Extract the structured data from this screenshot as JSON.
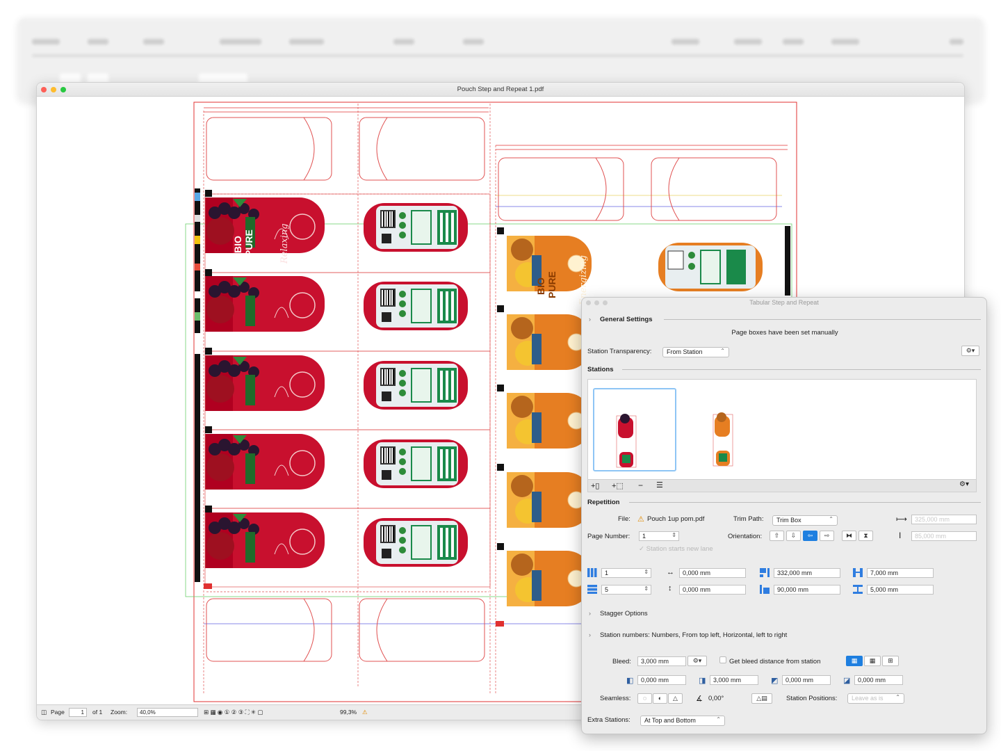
{
  "document": {
    "title": "Pouch Step and Repeat 1.pdf"
  },
  "statusbar": {
    "page_label": "Page",
    "page_value": "1",
    "of_label": "of 1",
    "zoom_label": "Zoom:",
    "zoom_value": "40,0%",
    "coverage_value": "99,3%"
  },
  "artwork": {
    "left_brand_line1": "BIO",
    "left_brand_line2": "PURE",
    "left_flavor": "Relaxing",
    "right_flavor": "Energizing",
    "left_color": "#c8102e",
    "right_color": "#e67e22",
    "nutrition_color": "#1a8a4a"
  },
  "panel": {
    "title": "Tabular Step and Repeat",
    "general_settings": "General Settings",
    "manual_note": "Page boxes have been set manually",
    "station_transparency_label": "Station Transparency:",
    "station_transparency_value": "From Station",
    "stations_label": "Stations",
    "repetition_label": "Repetition",
    "file_label": "File:",
    "file_value": "Pouch 1up pom.pdf",
    "trim_path_label": "Trim Path:",
    "trim_path_value": "Trim Box",
    "width_value": "325,000 mm",
    "height_value": "85,000 mm",
    "page_number_label": "Page Number:",
    "page_number_value": "1",
    "orientation_label": "Orientation:",
    "station_new_lane": "Station starts new lane",
    "columns_value": "1",
    "rows_value": "5",
    "hgap_value": "0,000 mm",
    "vgap_value": "0,000 mm",
    "step_h_value": "332,000 mm",
    "step_v_value": "90,000 mm",
    "margin_h_value": "7,000 mm",
    "margin_v_value": "5,000 mm",
    "stagger_options": "Stagger Options",
    "station_numbers": "Station numbers: Numbers, From top left, Horizontal, left to right",
    "bleed_label": "Bleed:",
    "bleed_value": "3,000 mm",
    "get_bleed_label": "Get bleed distance from station",
    "bleed_left": "0,000 mm",
    "bleed_top": "3,000 mm",
    "bleed_right": "0,000 mm",
    "bleed_bottom": "0,000 mm",
    "seamless_label": "Seamless:",
    "angle_value": "0,00°",
    "station_positions_label": "Station Positions:",
    "station_positions_value": "Leave as is",
    "extra_stations_label": "Extra Stations:",
    "extra_stations_value": "At Top and Bottom",
    "accent_color": "#1e7fe0"
  }
}
